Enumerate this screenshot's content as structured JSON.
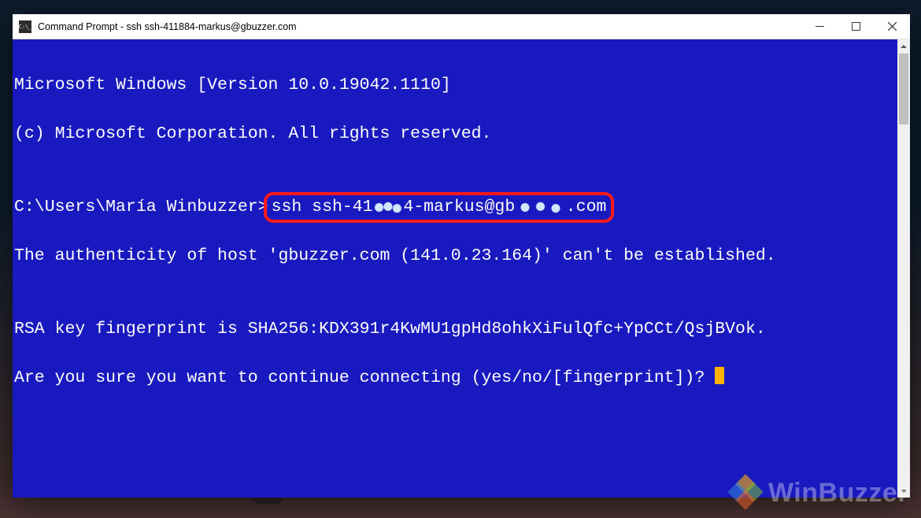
{
  "window": {
    "title": "Command Prompt - ssh  ssh-411884-markus@gbuzzer.com"
  },
  "terminal": {
    "line1": "Microsoft Windows [Version 10.0.19042.1110]",
    "line2": "(c) Microsoft Corporation. All rights reserved.",
    "blank1": "",
    "prompt": "C:\\Users\\María Winbuzzer>",
    "cmd_pre": "ssh ssh-41",
    "cmd_ob1": "188",
    "cmd_mid": "4-markus@gb",
    "cmd_ob2": "uzzer",
    "cmd_post": ".com",
    "line4": "The authenticity of host 'gbuzzer.com (141.0.23.164)' can't be established.",
    "blank2": "",
    "line5": "RSA key fingerprint is SHA256:KDX391r4KwMU1gpHd8ohkXiFulQfc+YpCCt/QsjBVok.",
    "line6": "Are you sure you want to continue connecting (yes/no/[fingerprint])? "
  },
  "watermark": {
    "text": "WinBuzzer"
  }
}
